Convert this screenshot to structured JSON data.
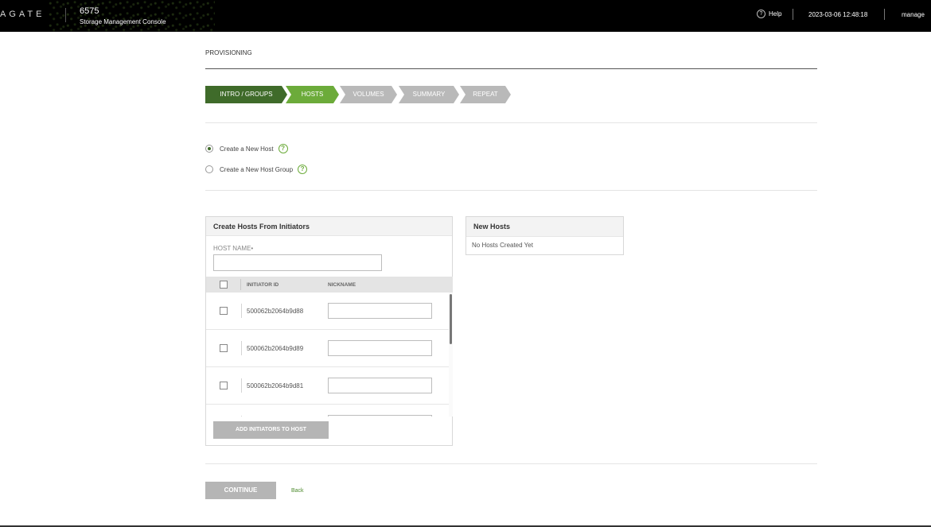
{
  "header": {
    "brand": "AGATE",
    "model": "6575",
    "console_name": "Storage Management Console",
    "help_label": "Help",
    "datetime": "2023-03-06 12:48:18",
    "user": "manage"
  },
  "page": {
    "title": "PROVISIONING"
  },
  "wizard": {
    "steps": [
      {
        "label": "INTRO / GROUPS",
        "state": "done"
      },
      {
        "label": "HOSTS",
        "state": "active"
      },
      {
        "label": "VOLUMES",
        "state": "todo"
      },
      {
        "label": "SUMMARY",
        "state": "todo"
      },
      {
        "label": "REPEAT",
        "state": "todo"
      }
    ]
  },
  "options": [
    {
      "label": "Create a New Host",
      "selected": true
    },
    {
      "label": "Create a New Host Group",
      "selected": false
    }
  ],
  "create_panel": {
    "title": "Create Hosts From Initiators",
    "host_name_label": "HOST NAME•",
    "host_name_value": "",
    "columns": {
      "initiator": "INITIATOR ID",
      "nickname": "NICKNAME"
    },
    "rows": [
      {
        "initiator_id": "500062b2064b9d88",
        "nickname": "",
        "checked": false
      },
      {
        "initiator_id": "500062b2064b9d89",
        "nickname": "",
        "checked": false
      },
      {
        "initiator_id": "500062b2064b9d81",
        "nickname": "",
        "checked": false
      },
      {
        "initiator_id": "",
        "nickname": "",
        "checked": false
      }
    ],
    "add_button": "ADD INITIATORS TO HOST"
  },
  "new_hosts_panel": {
    "title": "New Hosts",
    "empty_text": "No Hosts Created Yet"
  },
  "footer": {
    "continue_label": "CONTINUE",
    "back_label": "Back"
  },
  "colors": {
    "step_done": "#3f6b2a",
    "step_active": "#6cab3a",
    "step_todo": "#b9b9b9",
    "link_green": "#4c8a2c"
  }
}
